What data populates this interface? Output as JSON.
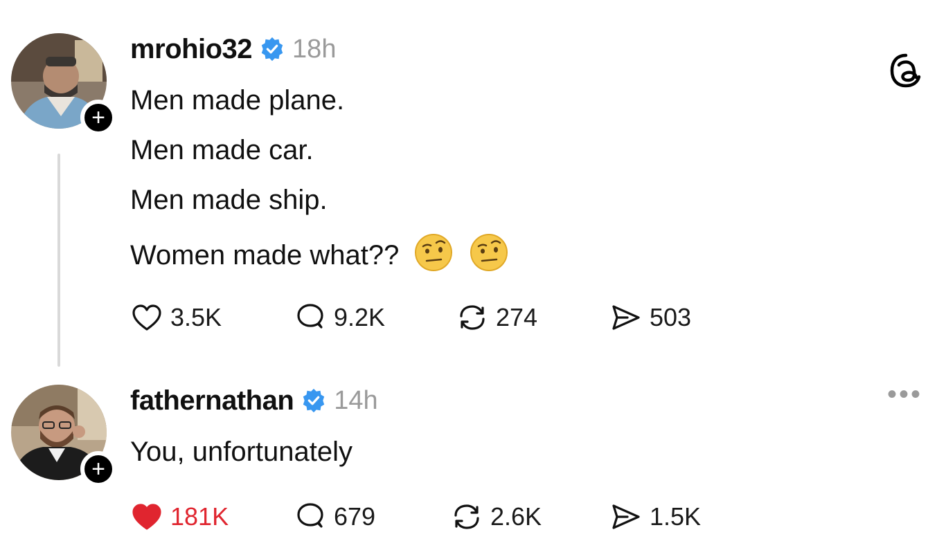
{
  "posts": [
    {
      "username": "mrohio32",
      "time": "18h",
      "lines": [
        "Men made plane.",
        "Men made car.",
        "Men made ship.",
        "Women made what??"
      ],
      "emojis": [
        "raised-eyebrow-emoji",
        "raised-eyebrow-emoji"
      ],
      "stats": {
        "likes": "3.5K",
        "comments": "9.2K",
        "reposts": "274",
        "shares": "503"
      },
      "liked": false
    },
    {
      "username": "fathernathan",
      "time": "14h",
      "lines": [
        "You, unfortunately"
      ],
      "stats": {
        "likes": "181K",
        "comments": "679",
        "reposts": "2.6K",
        "shares": "1.5K"
      },
      "liked": true
    }
  ],
  "colors": {
    "verified": "#3897f0",
    "like_active": "#e0252f",
    "muted_text": "#9a9a9a"
  },
  "icons": {
    "app_logo": "threads-logo-icon",
    "more": "more-options-icon"
  }
}
